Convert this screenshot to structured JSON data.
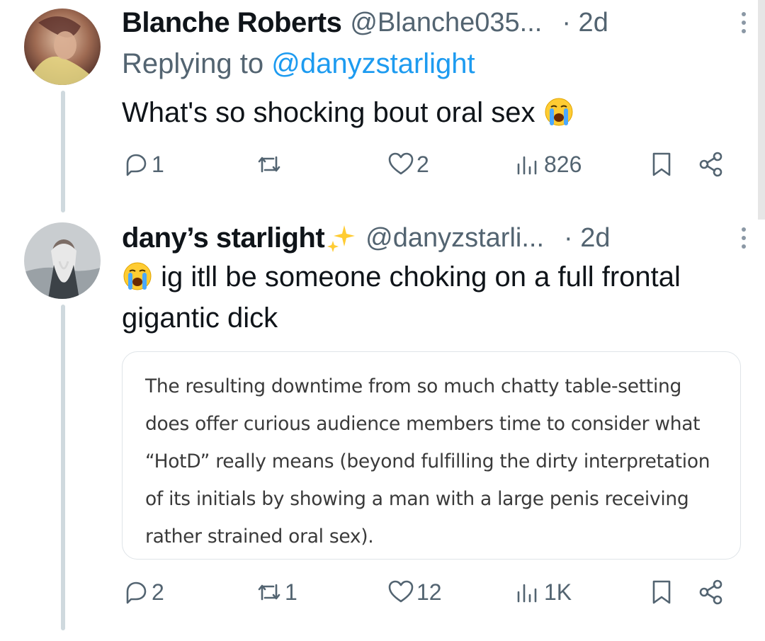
{
  "tweets": [
    {
      "name": "Blanche Roberts",
      "handle": "@Blanche035...",
      "time": "· 2d",
      "replying_prefix": "Replying to ",
      "replying_to": "@danyzstarlight",
      "text": "What's so shocking bout oral sex",
      "emoji": "loudly-crying-face",
      "stats": {
        "replies": "1",
        "retweets": "",
        "likes": "2",
        "views": "826"
      }
    },
    {
      "name": "dany’s starlight",
      "name_emoji": "sparkles",
      "handle": "@danyzstarli...",
      "time": "· 2d",
      "emoji": "loudly-crying-face",
      "text": "ig itll be someone choking on a full frontal gigantic dick",
      "quote_text": "The resulting downtime from so much chatty table-setting does offer curious audience members time to consider what “HotD” really means (beyond fulfilling the dirty interpretation of its initials by showing a man with a large penis receiving rather strained oral sex).",
      "stats": {
        "replies": "2",
        "retweets": "1",
        "likes": "12",
        "views": "1K"
      }
    }
  ],
  "colors": {
    "text": "#0f1419",
    "secondary": "#536471",
    "link": "#1d9bf0",
    "thread_line": "#cfd9de"
  }
}
